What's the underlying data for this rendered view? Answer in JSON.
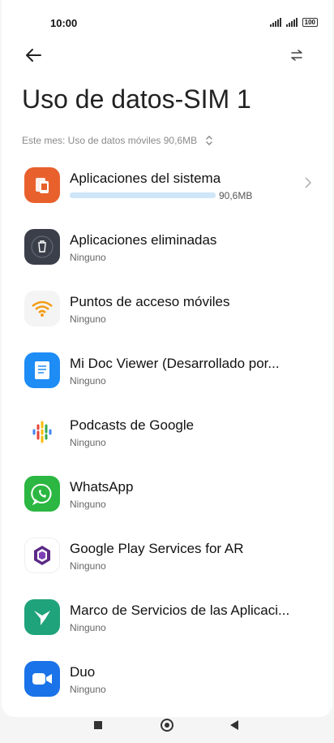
{
  "status_bar": {
    "time": "10:00",
    "battery": "100"
  },
  "header": {
    "title": "Uso de datos-SIM 1"
  },
  "filter": {
    "label": "Este mes: Uso de datos móviles 90,6MB"
  },
  "apps": [
    {
      "name": "Aplicaciones del sistema",
      "usage": "90,6MB",
      "usage_fraction": 1.0,
      "icon": "system-apps-icon",
      "color": "#e8612c"
    },
    {
      "name": "Aplicaciones eliminadas",
      "sub": "Ninguno",
      "icon": "trash-icon",
      "color": "#3b3f4a"
    },
    {
      "name": "Puntos de acceso móviles",
      "sub": "Ninguno",
      "icon": "wifi-hotspot-icon",
      "color": "#f4f4f4"
    },
    {
      "name": "Mi Doc Viewer (Desarrollado por...",
      "sub": "Ninguno",
      "icon": "doc-viewer-icon",
      "color": "#1e8cf5"
    },
    {
      "name": "Podcasts de Google",
      "sub": "Ninguno",
      "icon": "google-podcasts-icon",
      "color": "#ffffff"
    },
    {
      "name": "WhatsApp",
      "sub": "Ninguno",
      "icon": "whatsapp-icon",
      "color": "#2bb741"
    },
    {
      "name": "Google Play Services for AR",
      "sub": "Ninguno",
      "icon": "arcore-icon",
      "color": "#ffffff"
    },
    {
      "name": "Marco de Servicios de las Aplicaci...",
      "sub": "Ninguno",
      "icon": "hummingbird-icon",
      "color": "#1fa37a"
    },
    {
      "name": "Duo",
      "sub": "Ninguno",
      "icon": "duo-video-icon",
      "color": "#1a73e8"
    }
  ]
}
